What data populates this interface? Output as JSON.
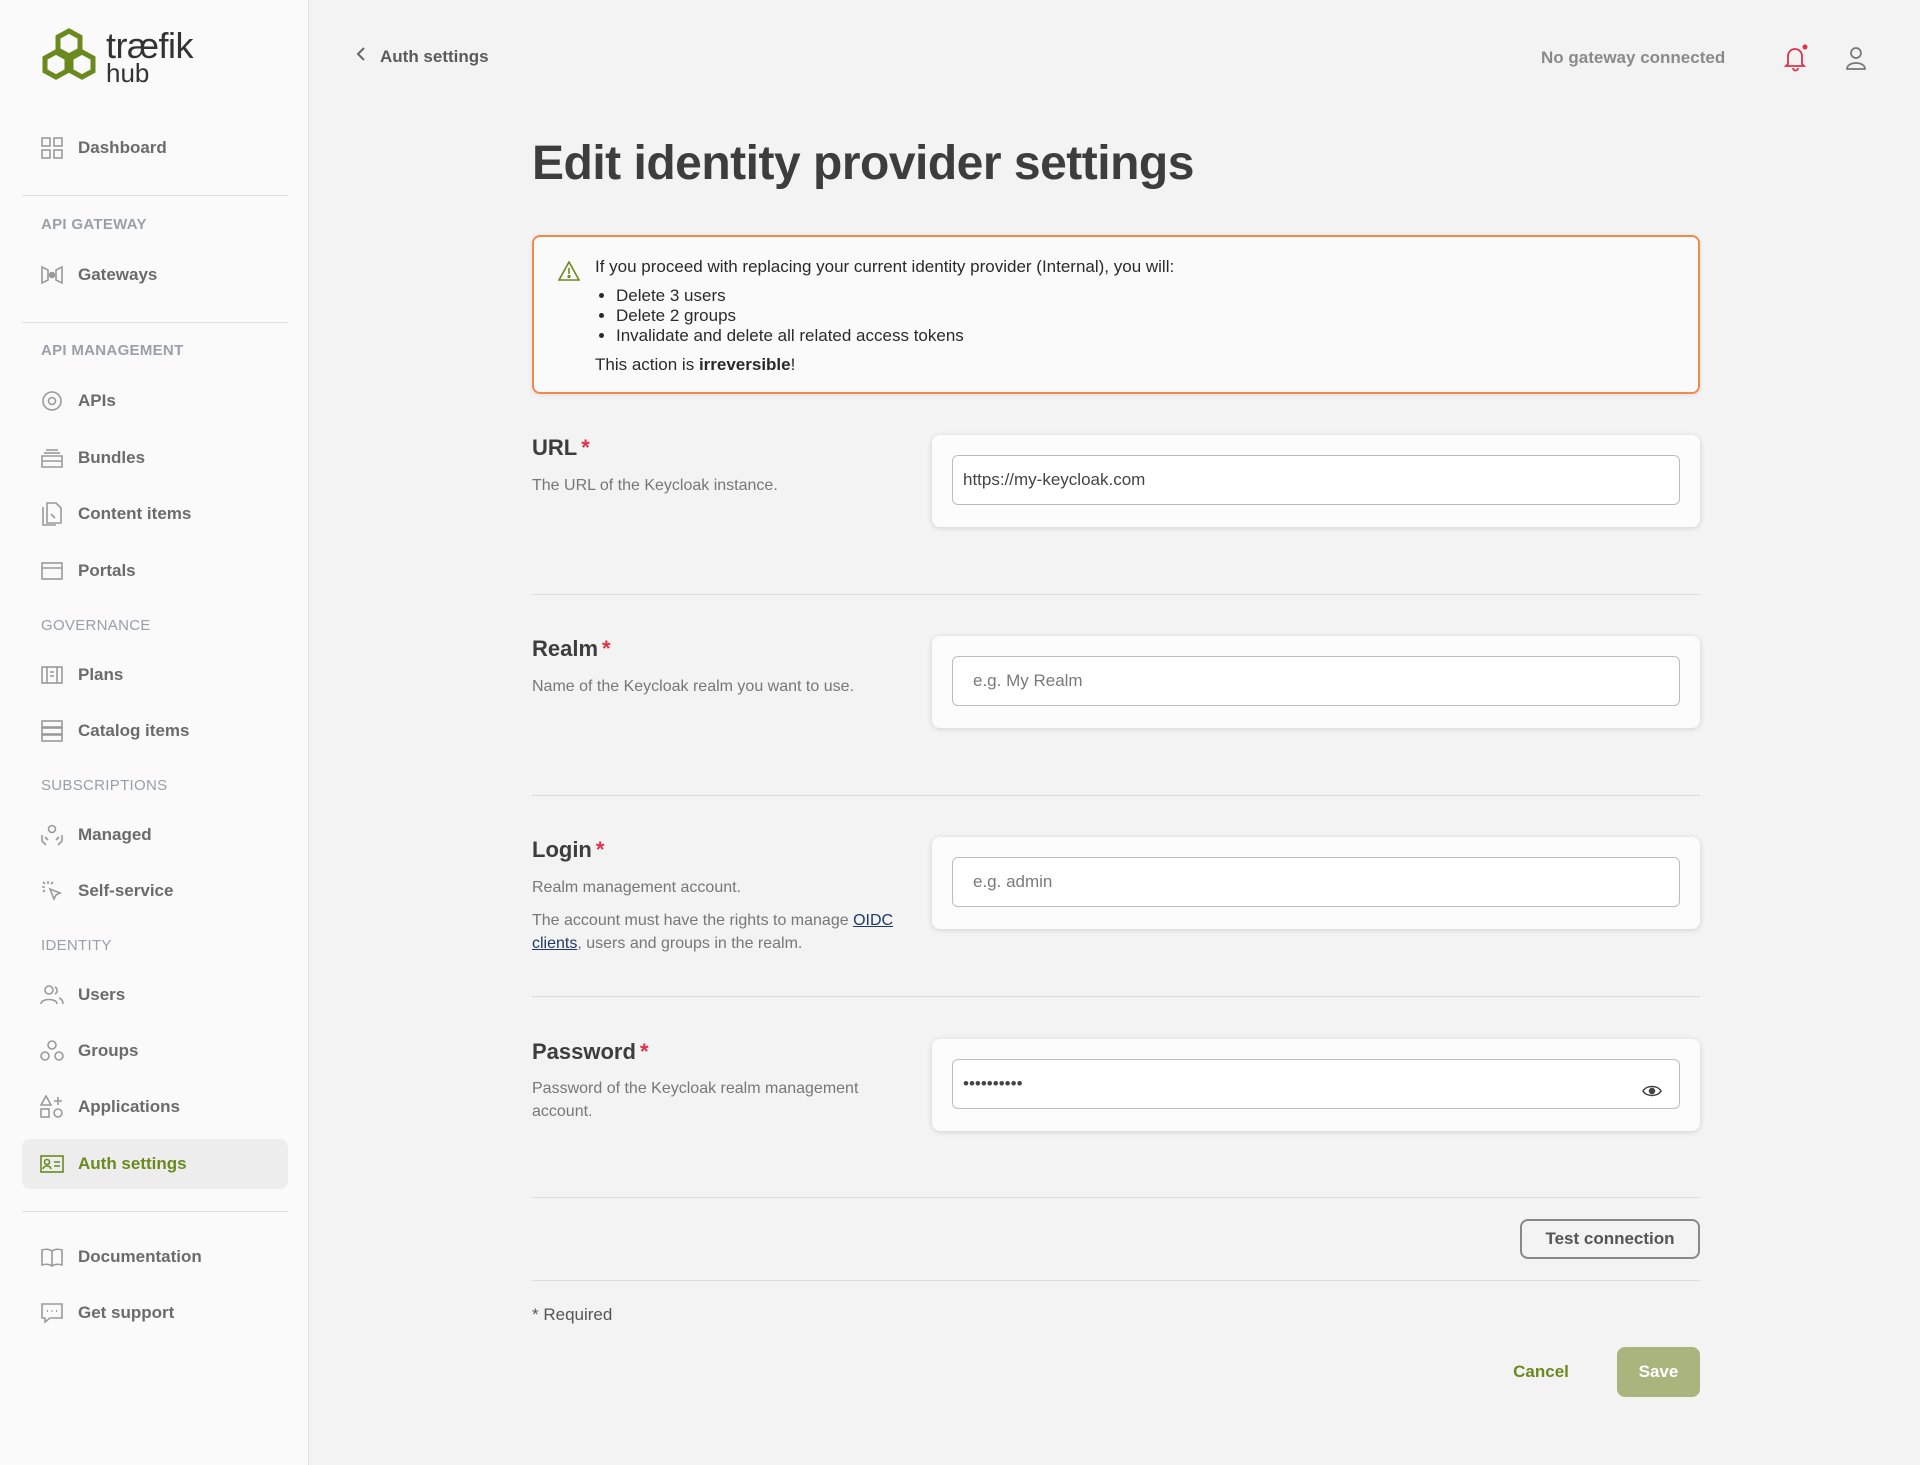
{
  "brand": {
    "logo_line1": "træfik",
    "logo_line2": "hub",
    "accent_color": "#6a8a20"
  },
  "sidebar": {
    "dashboard": "Dashboard",
    "sections": {
      "api_gateway": "API GATEWAY",
      "api_management": "API MANAGEMENT",
      "governance": "GOVERNANCE",
      "subscriptions": "SUBSCRIPTIONS",
      "identity": "IDENTITY"
    },
    "items": {
      "gateways": "Gateways",
      "apis": "APIs",
      "bundles": "Bundles",
      "content_items": "Content items",
      "portals": "Portals",
      "plans": "Plans",
      "catalog_items": "Catalog items",
      "managed": "Managed",
      "self_service": "Self-service",
      "users": "Users",
      "groups": "Groups",
      "applications": "Applications",
      "auth_settings": "Auth settings",
      "documentation": "Documentation",
      "get_support": "Get support"
    }
  },
  "topbar": {
    "back_label": "Auth settings",
    "gateway_status": "No gateway connected"
  },
  "page": {
    "title": "Edit identity provider settings",
    "warning": {
      "intro": "If you proceed with replacing your current identity provider (Internal), you will:",
      "bullets": [
        "Delete 3 users",
        "Delete 2 groups",
        "Invalidate and delete all related access tokens"
      ],
      "end_prefix": "This action is ",
      "end_bold": "irreversible",
      "end_suffix": "!"
    },
    "fields": {
      "url": {
        "label": "URL",
        "required_mark": "*",
        "desc": "The URL of the Keycloak instance.",
        "value": "https://my-keycloak.com"
      },
      "realm": {
        "label": "Realm",
        "required_mark": "*",
        "desc": "Name of the Keycloak realm you want to use.",
        "placeholder": "e.g. My Realm"
      },
      "login": {
        "label": "Login",
        "required_mark": "*",
        "desc1": "Realm management account.",
        "desc2_prefix": "The account must have the rights to manage ",
        "desc2_link": "OIDC clients",
        "desc2_suffix": ", users and groups in the realm.",
        "placeholder": "e.g. admin"
      },
      "password": {
        "label": "Password",
        "required_mark": "*",
        "desc": "Password of the Keycloak realm management account.",
        "value": "••••••••••"
      }
    },
    "test_connection": "Test connection",
    "required_note": "* Required",
    "cancel": "Cancel",
    "save": "Save"
  }
}
